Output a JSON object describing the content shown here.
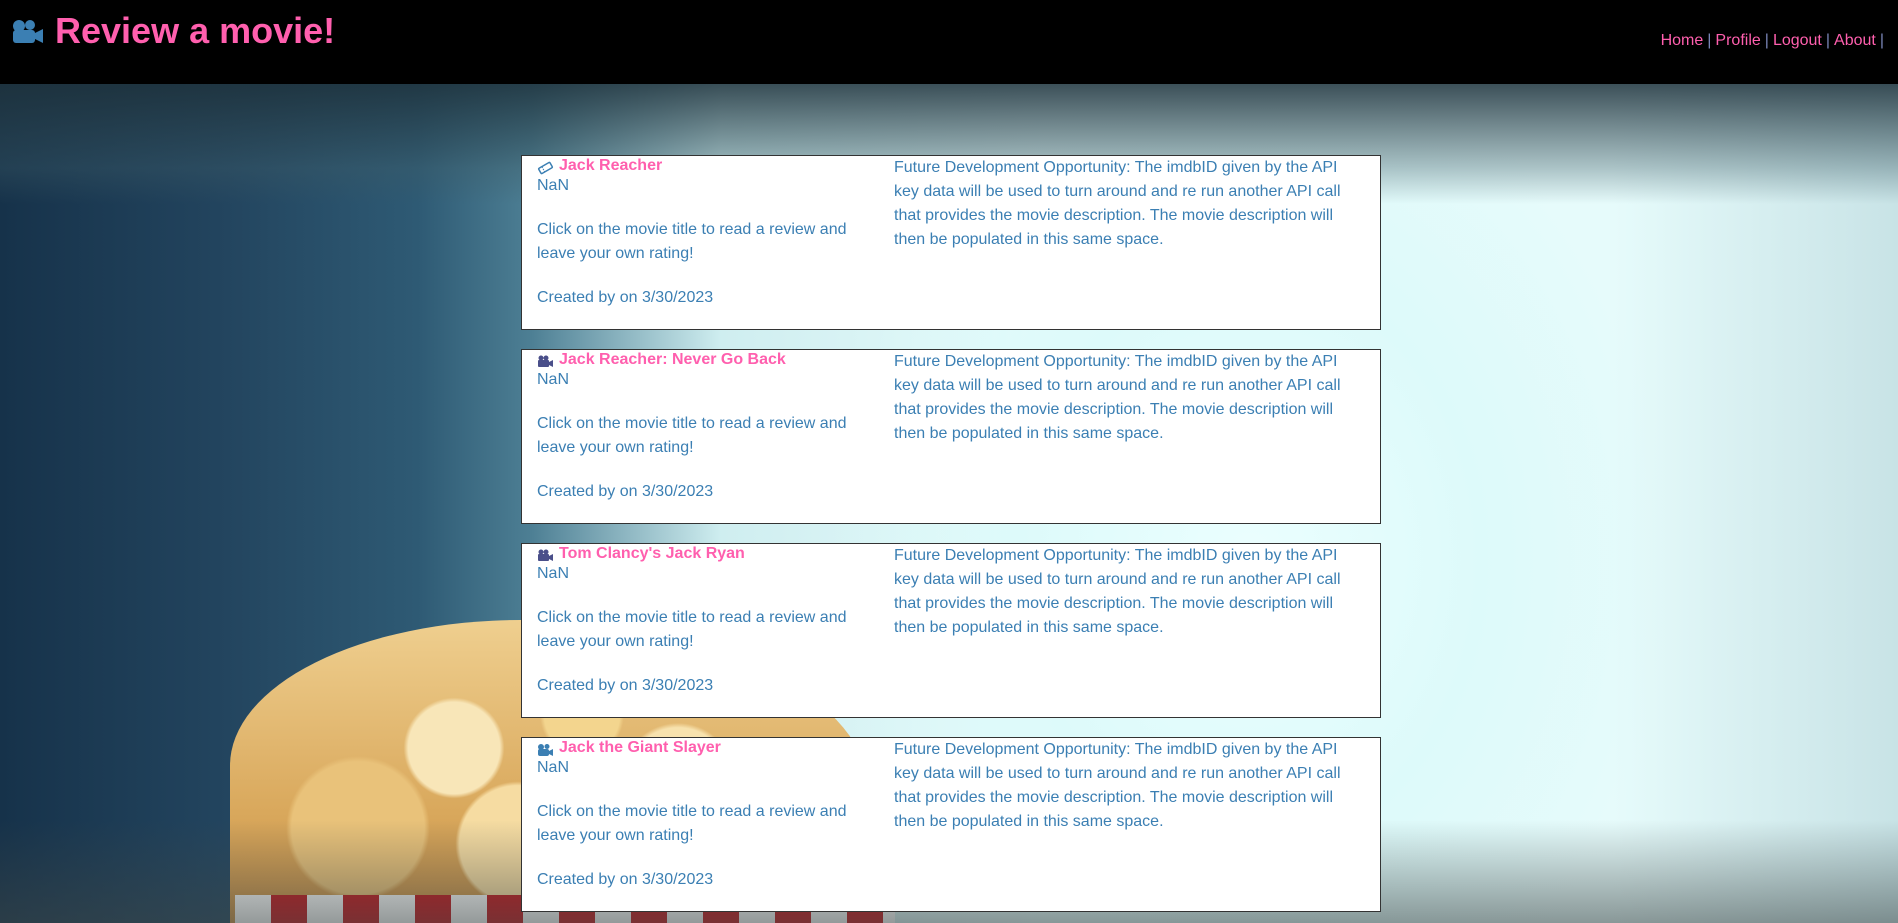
{
  "header": {
    "title": "Review a movie!",
    "nav": [
      {
        "label": "Home"
      },
      {
        "label": "Profile"
      },
      {
        "label": "Logout"
      },
      {
        "label": "About"
      }
    ],
    "separator": "|"
  },
  "colors": {
    "header_bg": "#000000",
    "accent_pink": "#ff5fae",
    "text_blue": "#3b7fb3",
    "card_bg": "#ffffff"
  },
  "icons": [
    "camera-icon",
    "ticket-icon",
    "film-camera-icon"
  ],
  "movies": [
    {
      "icon": "ticket-icon",
      "title": "Jack Reacher",
      "rating": "NaN",
      "hint": "Click on the movie title to read a review and leave your own rating!",
      "created": "Created by on 3/30/2023",
      "description": "Future Development Opportunity: The imdbID given by the API key data will be used to turn around and re run another API call that provides the movie description. The movie description will then be populated in this same space."
    },
    {
      "icon": "film-camera-icon",
      "title": "Jack Reacher: Never Go Back",
      "rating": "NaN",
      "hint": "Click on the movie title to read a review and leave your own rating!",
      "created": "Created by on 3/30/2023",
      "description": "Future Development Opportunity: The imdbID given by the API key data will be used to turn around and re run another API call that provides the movie description. The movie description will then be populated in this same space."
    },
    {
      "icon": "film-camera-icon",
      "title": "Tom Clancy's Jack Ryan",
      "rating": "NaN",
      "hint": "Click on the movie title to read a review and leave your own rating!",
      "created": "Created by on 3/30/2023",
      "description": "Future Development Opportunity: The imdbID given by the API key data will be used to turn around and re run another API call that provides the movie description. The movie description will then be populated in this same space."
    },
    {
      "icon": "camera-icon",
      "title": "Jack the Giant Slayer",
      "rating": "NaN",
      "hint": "Click on the movie title to read a review and leave your own rating!",
      "created": "Created by on 3/30/2023",
      "description": "Future Development Opportunity: The imdbID given by the API key data will be used to turn around and re run another API call that provides the movie description. The movie description will then be populated in this same space."
    }
  ]
}
